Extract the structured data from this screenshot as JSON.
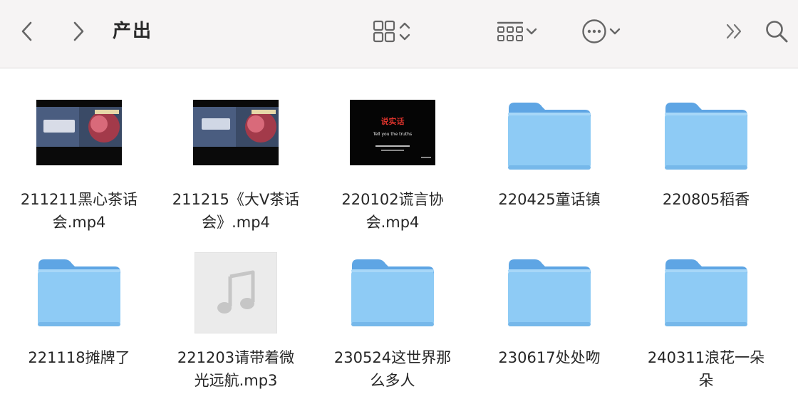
{
  "window": {
    "title": "产出"
  },
  "toolbar": {
    "back_icon": "chevron-left-icon",
    "forward_icon": "chevron-right-icon",
    "view_icon": "grid-view-icon",
    "group_icon": "group-by-icon",
    "action_icon": "ellipsis-circle-icon",
    "overflow_icon": "double-chevron-icon",
    "search_icon": "search-icon"
  },
  "files": [
    {
      "name_line1": "211211黑心茶话",
      "name_line2": "会.mp4",
      "kind": "video"
    },
    {
      "name_line1": "211215《大Ⅴ茶话",
      "name_line2": "会》.mp4",
      "kind": "video"
    },
    {
      "name_line1": "220102谎言协",
      "name_line2": "会.mp4",
      "kind": "video",
      "thumb_text": "说实话",
      "thumb_subtext": "Tell you the truths"
    },
    {
      "name_line1": "220425童话镇",
      "name_line2": "",
      "kind": "folder"
    },
    {
      "name_line1": "220805稻香",
      "name_line2": "",
      "kind": "folder"
    },
    {
      "name_line1": "221118摊牌了",
      "name_line2": "",
      "kind": "folder"
    },
    {
      "name_line1": "221203请带着微",
      "name_line2": "光远航.mp3",
      "kind": "audio"
    },
    {
      "name_line1": "230524这世界那",
      "name_line2": "么多人",
      "kind": "folder"
    },
    {
      "name_line1": "230617处处吻",
      "name_line2": "",
      "kind": "folder"
    },
    {
      "name_line1": "240311浪花一朵",
      "name_line2": "朵",
      "kind": "folder"
    }
  ],
  "colors": {
    "toolbar_bg": "#f6f4f4",
    "folder_body": "#8ecbf5",
    "folder_tab": "#6fb3ea"
  }
}
